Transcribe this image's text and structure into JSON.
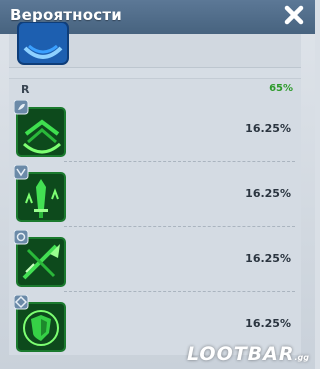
{
  "window": {
    "title": "Вероятности",
    "close_icon": "close-x-icon"
  },
  "group": {
    "rarity": "R",
    "total_chance": "65%",
    "items": [
      {
        "icon": "layered-chevron-shield-icon",
        "chance": "16.25%"
      },
      {
        "icon": "sword-upgrade-icon",
        "chance": "16.25%"
      },
      {
        "icon": "crossed-blades-icon",
        "chance": "16.25%"
      },
      {
        "icon": "shield-ring-icon",
        "chance": "16.25%"
      }
    ]
  },
  "watermark": {
    "text": "LOOTBAR",
    "suffix": ".gg"
  },
  "colors": {
    "header": "#4f6b89",
    "accent_green": "#2e9b2c",
    "icon_green": "#36d046"
  }
}
